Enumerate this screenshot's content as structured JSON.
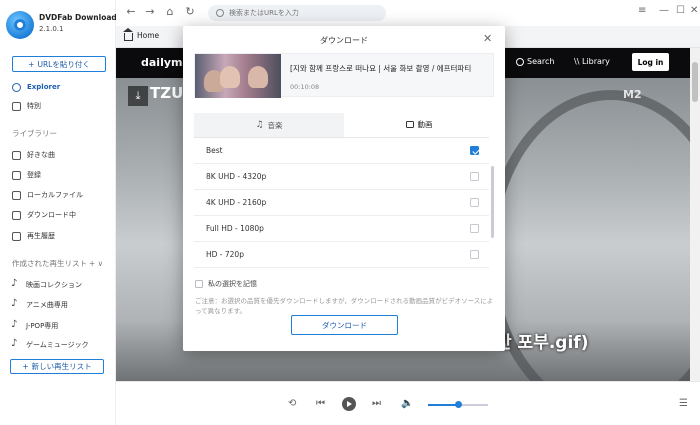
{
  "app": {
    "name": "DVDFab Downloader",
    "version": "2.1.0.1"
  },
  "sidebar": {
    "paste_url_label": "URLを貼り付く",
    "nav": [
      {
        "label": "Explorer",
        "icon": "compass-icon",
        "active": true
      },
      {
        "label": "特別",
        "icon": "special-icon"
      }
    ],
    "library_label": "ライブラリー",
    "library_items": [
      {
        "label": "好きな曲",
        "icon": "heart-icon"
      },
      {
        "label": "登録",
        "icon": "subscribe-icon"
      },
      {
        "label": "ローカルファイル",
        "icon": "folder-icon"
      },
      {
        "label": "ダウンロード中",
        "icon": "download-icon"
      },
      {
        "label": "再生履歴",
        "icon": "history-icon"
      }
    ],
    "playlists_label": "作成された再生リスト",
    "playlists": [
      {
        "label": "映画コレクション"
      },
      {
        "label": "アニメ曲専用"
      },
      {
        "label": "J-POP専用"
      },
      {
        "label": "ゲームミュージック"
      }
    ],
    "new_playlist_label": "新しい再生リスト"
  },
  "topbar": {
    "url_placeholder": "検索またはURLを入力"
  },
  "tabbar": {
    "home_label": "Home"
  },
  "site": {
    "logo": "dailymotion",
    "search_label": "Search",
    "library_label": "Library",
    "login_label": "Log in",
    "overlay_text": "TZU",
    "corner_text": "M2",
    "subtitle_text": "간 포부.gif)"
  },
  "modal": {
    "title": "ダウンロード",
    "video_title": "[지와 함께 프랑스로 떠나요 | 서울 화보 촬영 / 에프터파티",
    "duration": "00:10:08",
    "tab_audio": "音楽",
    "tab_video": "動画",
    "active_tab": "video",
    "options": [
      {
        "label": "Best",
        "checked": true
      },
      {
        "label": "8K UHD - 4320p",
        "checked": false
      },
      {
        "label": "4K UHD - 2160p",
        "checked": false
      },
      {
        "label": "Full HD - 1080p",
        "checked": false
      },
      {
        "label": "HD - 720p",
        "checked": false
      }
    ],
    "remember_label": "私の選択を記憶",
    "notice": "ご注意：お選択の品質を優先ダウンロードしますが，ダウンロードされる動画品質がビデオソースによって異なります。",
    "download_button": "ダウンロード"
  },
  "player": {
    "volume": 0.5
  }
}
